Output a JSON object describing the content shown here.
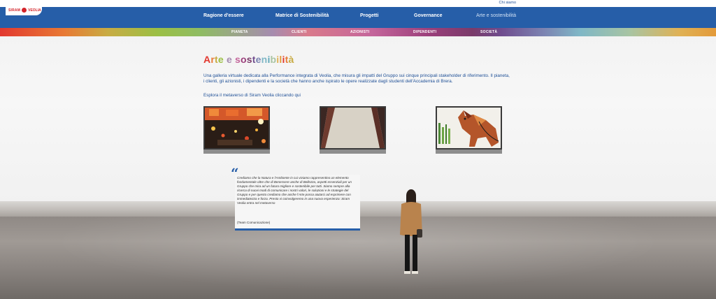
{
  "topbar": {
    "chi_siamo": "Chi siamo"
  },
  "logo": {
    "siram": "SIRAM",
    "veolia": "VEOLIA"
  },
  "nav": {
    "items": [
      {
        "label": "Ragione d'essere"
      },
      {
        "label": "Matrice di Sostenibilità"
      },
      {
        "label": "Progetti"
      },
      {
        "label": "Governance"
      },
      {
        "label": "Arte e sostenibilità"
      }
    ],
    "active": "Arte e sostenibilità"
  },
  "subnav": {
    "items": [
      {
        "label": "PIANETA"
      },
      {
        "label": "CLIENTI"
      },
      {
        "label": "AZIONISTI"
      },
      {
        "label": "DIPENDENTI"
      },
      {
        "label": "SOCIETÀ"
      }
    ]
  },
  "page": {
    "title": "Arte e sostenibilità",
    "title_colors": [
      "#e2382f",
      "#e87a35",
      "#c8ab43",
      "#9bbf45",
      "#8fbc63",
      "#a58caf",
      "#d97a8b",
      "#c4659b",
      "#9b3f7b",
      "#7a3b6a",
      "#6f4c8e",
      "#7c84b2",
      "#7fb7c6",
      "#5fa8b8",
      "#a8c4a2",
      "#e0b154",
      "#e39a3a",
      "#e2382f",
      "#e87a35",
      "#c8ab43"
    ],
    "intro": "Una galleria virtuale dedicata alla Performance integrata di Veolia, che misura gli impatti del Gruppo sui cinque principali stakeholder di riferimento. Il pianeta, i clienti, gli azionisti, i dipendenti e la società che hanno anche ispirato le opere realizzate dagli studenti dell'Accademia di Brera.",
    "metaverse_prefix": "Esplora il metaverso di Siram Veolia ",
    "metaverse_link": "cliccando qui"
  },
  "artworks": [
    {
      "name": "city-night-painting"
    },
    {
      "name": "abstract-canvas-painting"
    },
    {
      "name": "horse-painting"
    }
  ],
  "quote": {
    "mark": "“",
    "text": "Crediamo che la Natura e l'Ambiente in cui viviamo rappresentino un elemento fondamentale oltre che di Benessere anche di Bellezza, aspetti essenziali per un Gruppo che mira ad un futuro migliore e sostenibile per tutti. Siamo sempre alla ricerca di nuovi modi di comunicare i nostri valori, le soluzioni e le strategie del Gruppo e per questo crediamo che anche l'Arte possa aiutarci ad esprimere con immediatezza e forza. Presto vi coinvolgeremo in una nuova esperienza: Siram Veolia entra nel metaverso",
    "signature": "(Team Comunicazione)"
  },
  "colors": {
    "brand_blue": "#265ea8",
    "link_blue": "#1e4f96",
    "logo_red": "#d3242a"
  }
}
